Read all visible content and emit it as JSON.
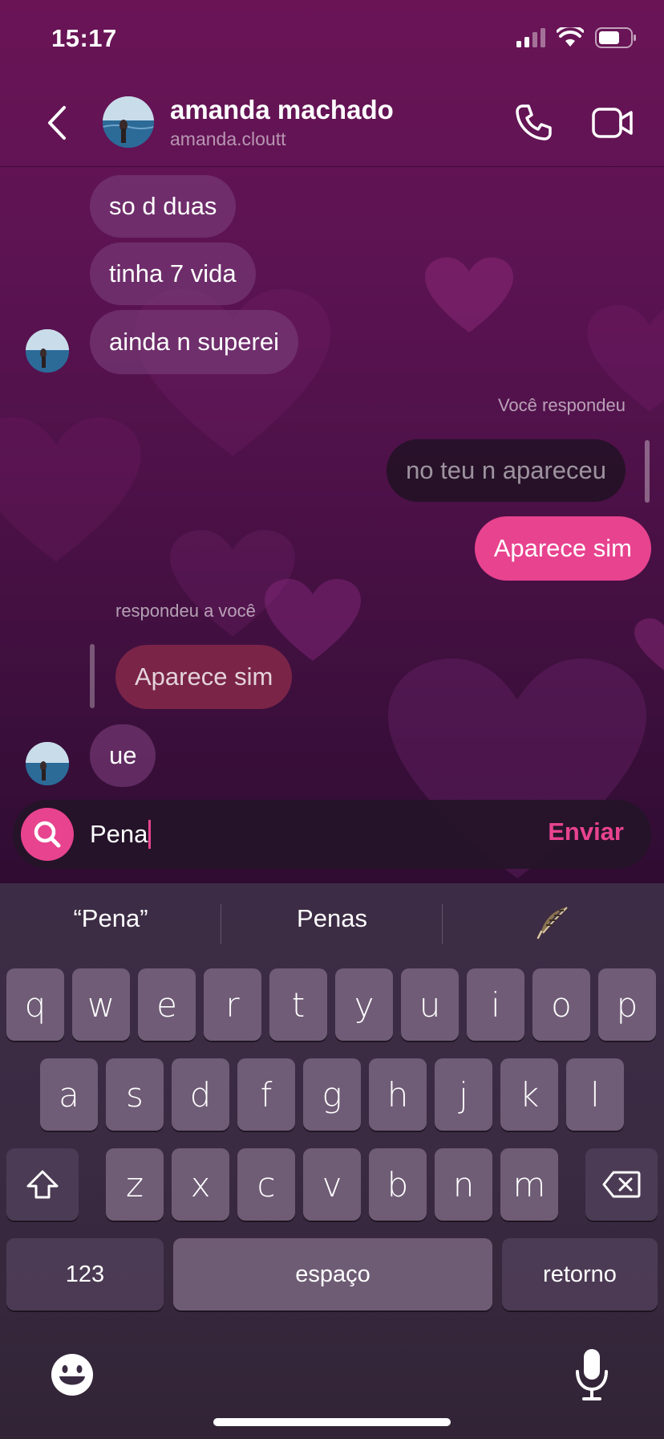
{
  "status_bar": {
    "time": "15:17"
  },
  "header": {
    "name": "amanda machado",
    "username": "amanda.cloutt"
  },
  "messages": {
    "in_1": "so d duas",
    "in_2": "tinha 7 vida",
    "in_3": "ainda n superei",
    "you_replied_label": "Você respondeu",
    "my_reply_quote": "no teu n apareceu",
    "my_message": "Aparece sim",
    "replied_to_you_label": "respondeu a você",
    "their_quote": "Aparece sim",
    "in_4": "ue"
  },
  "composer": {
    "text": "Pena",
    "send_label": "Enviar"
  },
  "keyboard": {
    "suggestions": [
      "“Pena”",
      "Penas"
    ],
    "row1": [
      "q",
      "w",
      "e",
      "r",
      "t",
      "y",
      "u",
      "i",
      "o",
      "p"
    ],
    "row2": [
      "a",
      "s",
      "d",
      "f",
      "g",
      "h",
      "j",
      "k",
      "l"
    ],
    "row3": [
      "z",
      "x",
      "c",
      "v",
      "b",
      "n",
      "m"
    ],
    "numbers_key": "123",
    "space_key": "espaço",
    "return_key": "retorno"
  },
  "colors": {
    "accent": "#e8438f",
    "header_bg": "#6a1456",
    "keyboard_bg": "#3a2a42"
  }
}
